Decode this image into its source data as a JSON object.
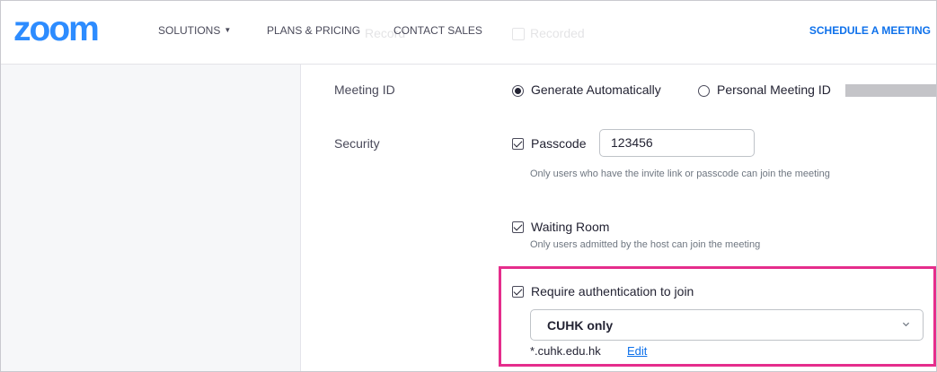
{
  "header": {
    "logo": "zoom",
    "nav": {
      "solutions": "SOLUTIONS",
      "plans": "PLANS & PRICING",
      "contact": "CONTACT SALES"
    },
    "schedule": "SCHEDULE A MEETING",
    "ghost_left": "Record",
    "ghost_right": "Recorded"
  },
  "meeting_id": {
    "label": "Meeting ID",
    "generate": "Generate Automatically",
    "personal": "Personal Meeting ID",
    "selected": "generate"
  },
  "security": {
    "label": "Security",
    "passcode": {
      "label": "Passcode",
      "value": "123456",
      "checked": true,
      "hint": "Only users who have the invite link or passcode can join the meeting"
    },
    "waiting_room": {
      "label": "Waiting Room",
      "checked": true,
      "hint": "Only users admitted by the host can join the meeting"
    },
    "require_auth": {
      "label": "Require authentication to join",
      "checked": true,
      "selected_option": "CUHK only",
      "domain": "*.cuhk.edu.hk",
      "edit": "Edit"
    }
  },
  "colors": {
    "brand": "#2d8cff",
    "link": "#0e71eb",
    "highlight": "#e52d8c"
  }
}
